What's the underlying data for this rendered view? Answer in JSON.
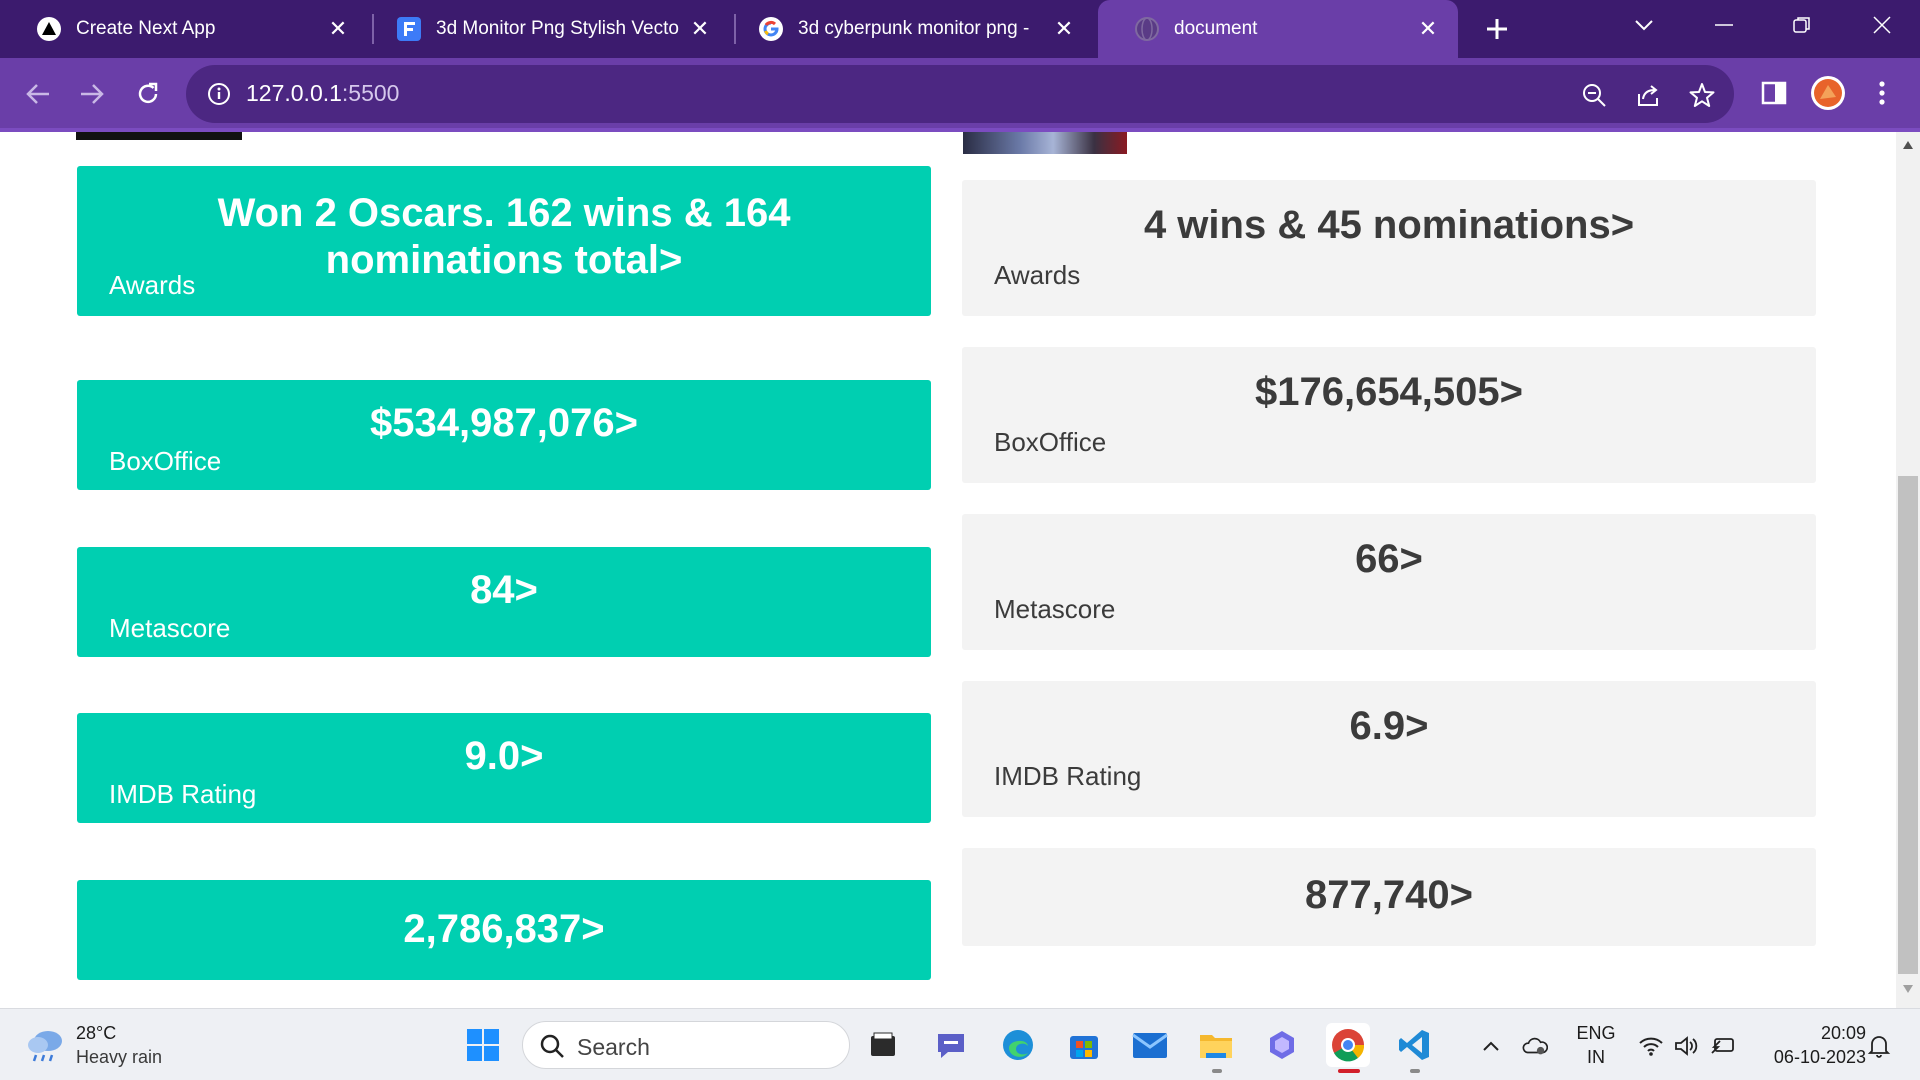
{
  "browser": {
    "tabs": [
      {
        "title": "Create Next App",
        "favicon": "nextjs-icon",
        "active": false
      },
      {
        "title": "3d Monitor Png Stylish Vecto",
        "favicon": "freepik-icon",
        "active": false
      },
      {
        "title": "3d cyberpunk monitor png -",
        "favicon": "google-icon",
        "active": false
      },
      {
        "title": "document",
        "favicon": "globe-icon",
        "active": true
      }
    ],
    "address": {
      "host": "127.0.0.1",
      "port": ":5500"
    },
    "colors": {
      "frame": "#3c1b6e",
      "toolbar": "#6a3ea8",
      "omnibox": "#4c2782"
    }
  },
  "page": {
    "left_cards": [
      {
        "value": "Won 2 Oscars. 162 wins & 164 nominations total>",
        "label": "Awards"
      },
      {
        "value": "$534,987,076>",
        "label": "BoxOffice"
      },
      {
        "value": "84>",
        "label": "Metascore"
      },
      {
        "value": "9.0>",
        "label": "IMDB Rating"
      },
      {
        "value": "2,786,837>",
        "label": ""
      }
    ],
    "right_cards": [
      {
        "value": "4 wins & 45 nominations>",
        "label": "Awards"
      },
      {
        "value": "$176,654,505>",
        "label": "BoxOffice"
      },
      {
        "value": "66>",
        "label": "Metascore"
      },
      {
        "value": "6.9>",
        "label": "IMDB Rating"
      },
      {
        "value": "877,740>",
        "label": ""
      }
    ],
    "colors": {
      "left_card": "#00cfb1",
      "right_card": "#f3f3f3",
      "right_text": "#3b3b3b"
    }
  },
  "taskbar": {
    "weather": {
      "temp": "28°C",
      "condition": "Heavy rain",
      "icon": "rain-cloud-icon"
    },
    "search_label": "Search",
    "apps": [
      "windows-start-icon",
      "file-explorer-dark-icon",
      "teams-chat-icon",
      "edge-icon",
      "microsoft-store-icon",
      "mail-icon",
      "folder-icon",
      "copilot-icon",
      "chrome-icon",
      "vscode-icon"
    ],
    "tray": {
      "lang_line1": "ENG",
      "lang_line2": "IN",
      "time": "20:09",
      "date": "06-10-2023"
    }
  }
}
